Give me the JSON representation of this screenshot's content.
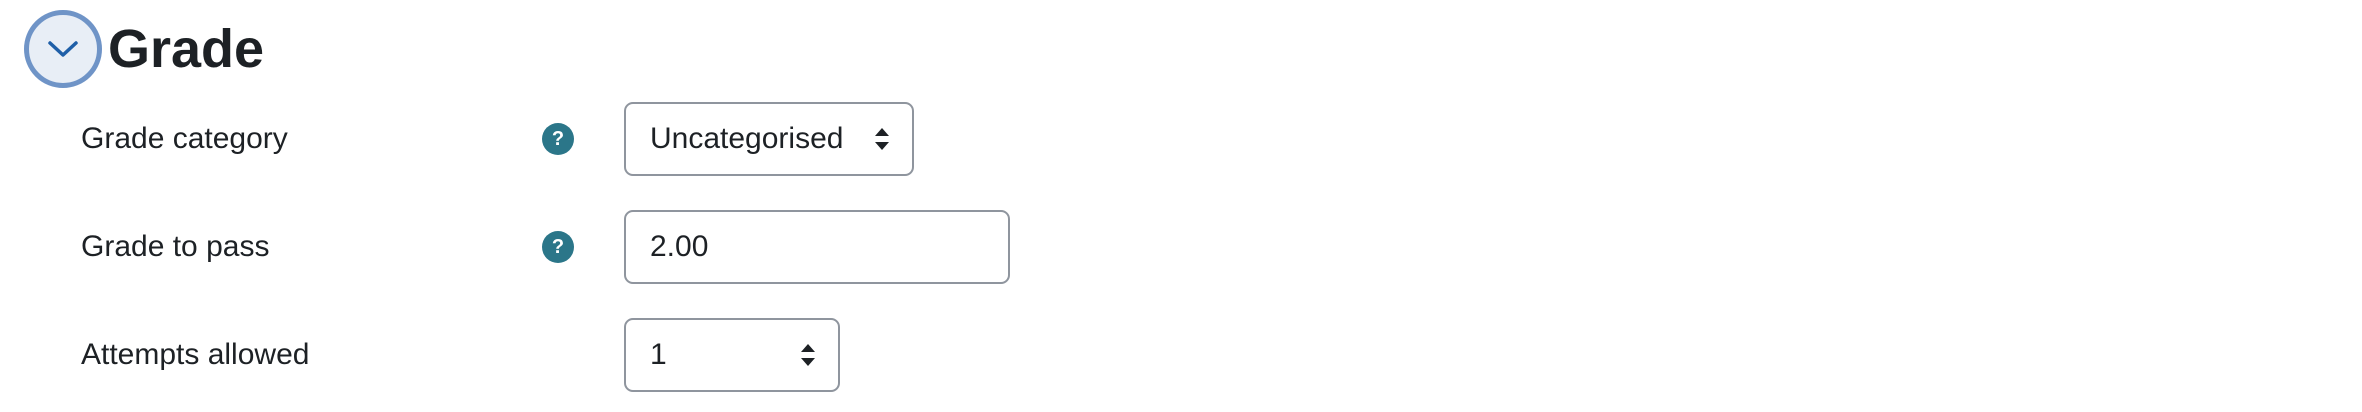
{
  "section": {
    "title": "Grade",
    "toggle_icon": "chevron-down-icon"
  },
  "fields": {
    "grade_category": {
      "label": "Grade category",
      "help_glyph": "?",
      "value": "Uncategorised",
      "help_icon": "help-icon"
    },
    "grade_to_pass": {
      "label": "Grade to pass",
      "help_glyph": "?",
      "value": "2.00",
      "help_icon": "help-icon"
    },
    "attempts_allowed": {
      "label": "Attempts allowed",
      "value": "1"
    }
  },
  "colors": {
    "help_icon": "#2b7689",
    "toggle_border": "#6f94c7",
    "toggle_fill": "#e8eef6",
    "control_border": "#8f959e",
    "text": "#1d2125"
  }
}
